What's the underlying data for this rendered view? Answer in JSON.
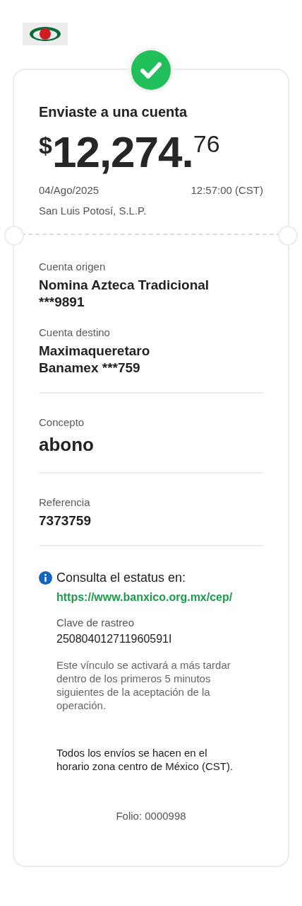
{
  "header": {
    "title": "Enviaste a una cuenta",
    "amount": {
      "currency": "$",
      "whole": "12,274.",
      "cents": "76"
    },
    "date": "04/Ago/2025",
    "time": "12:57:00 (CST)",
    "location": "San Luis Potosí, S.L.P."
  },
  "details": [
    {
      "kind": "field",
      "label": "Cuenta origen",
      "lines": [
        "Nomina Azteca Tradicional",
        "***9891"
      ]
    },
    {
      "kind": "field",
      "label": "Cuenta destino",
      "lines": [
        "Maximaqueretaro",
        "Banamex ***759"
      ]
    },
    {
      "kind": "rule"
    },
    {
      "kind": "large",
      "label": "Concepto",
      "lines": [
        "abono"
      ]
    },
    {
      "kind": "rule"
    },
    {
      "kind": "field",
      "label": "Referencia",
      "lines": [
        "7373759"
      ]
    },
    {
      "kind": "rule"
    }
  ],
  "status": {
    "title": "Consulta el estatus en:",
    "link": "https://www.banxico.org.mx/cep/",
    "tracking_label": "Clave de rastreo",
    "tracking_code": "250804012711960591I",
    "note": "Este vínculo se activará a más tardar dentro de los primeros 5 minutos siguientes de la aceptación de la operación.",
    "timezone_note": "Todos los envíos se hacen en el horario zona centro de México (CST)."
  },
  "folio": "Folio: 0000998"
}
